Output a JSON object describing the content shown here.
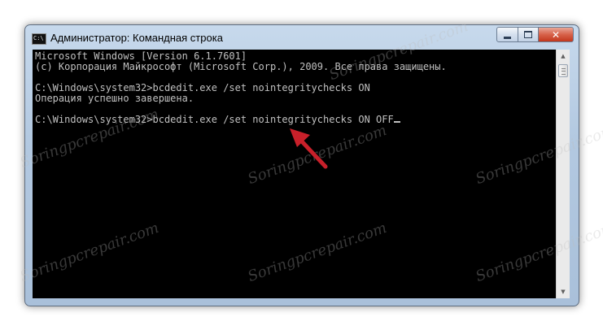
{
  "window": {
    "title": "Администратор: Командная строка",
    "icon_label": "C:\\",
    "controls": {
      "minimize": "minimize",
      "maximize": "maximize",
      "close": "✕"
    }
  },
  "console": {
    "lines": [
      "Microsoft Windows [Version 6.1.7601]",
      "(c) Корпорация Майкрософт (Microsoft Corp.), 2009. Все права защищены.",
      "",
      "C:\\Windows\\system32>bcdedit.exe /set nointegritychecks ON",
      "Операция успешно завершена.",
      "",
      "C:\\Windows\\system32>bcdedit.exe /set nointegritychecks ON OFF"
    ]
  },
  "watermark": "Soringpcrepair.com",
  "colors": {
    "console_bg": "#000000",
    "console_text": "#c0c0c0",
    "arrow": "#c8202a",
    "close_button": "#c94a32"
  },
  "icons": {
    "app": "cmd-icon",
    "scroll_up": "arrow-up-icon",
    "scroll_down": "arrow-down-icon"
  }
}
